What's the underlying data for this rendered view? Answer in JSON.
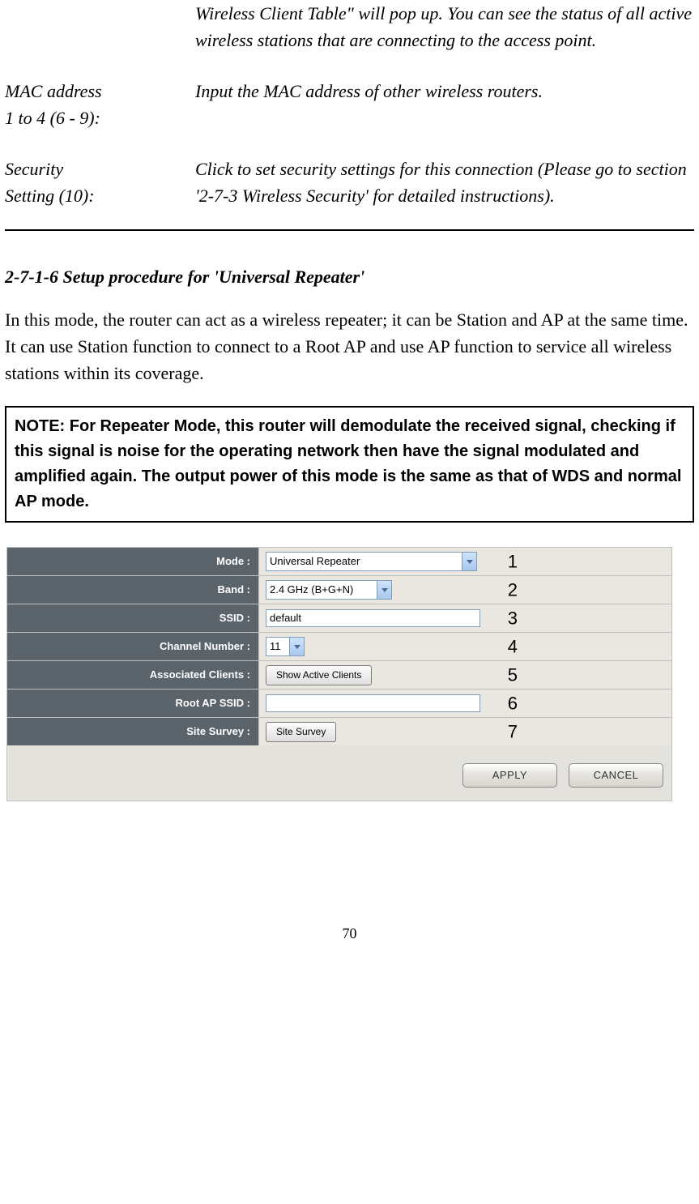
{
  "defs": {
    "intro_trailing": "Wireless Client Table\" will pop up. You can see the status of all active wireless stations that are connecting to the access point.",
    "mac_label_l1": "MAC address",
    "mac_label_l2": "1 to 4 (6 - 9):",
    "mac_text": "Input the MAC address of other wireless routers.",
    "sec_label_l1": "Security",
    "sec_label_l2": "Setting (10):",
    "sec_text": "Click to set security settings for this connection (Please go to section '2-7-3 Wireless Security' for detailed instructions)."
  },
  "section_title": "2-7-1-6 Setup procedure for 'Universal Repeater'",
  "body_para": "In this mode, the router can act as a wireless repeater; it can be Station and AP at the same time. It can use Station function to connect to a Root AP and use AP function to service all wireless stations within its coverage.",
  "note_text": "NOTE: For Repeater Mode, this router will demodulate the received signal, checking if this signal is noise for the operating network then have the signal modulated and amplified again. The output power of this mode is the same as that of WDS and normal AP mode.",
  "ui": {
    "rows": {
      "mode": {
        "label": "Mode :",
        "value": "Universal Repeater",
        "num": "1"
      },
      "band": {
        "label": "Band :",
        "value": "2.4 GHz (B+G+N)",
        "num": "2"
      },
      "ssid": {
        "label": "SSID :",
        "value": "default",
        "num": "3"
      },
      "chan": {
        "label": "Channel Number :",
        "value": "11",
        "num": "4"
      },
      "assoc": {
        "label": "Associated Clients :",
        "value": "Show Active Clients",
        "num": "5"
      },
      "root": {
        "label": "Root AP SSID :",
        "value": "",
        "num": "6"
      },
      "survey": {
        "label": "Site Survey :",
        "value": "Site Survey",
        "num": "7"
      }
    },
    "buttons": {
      "apply": "APPLY",
      "cancel": "CANCEL"
    }
  },
  "page_number": "70"
}
